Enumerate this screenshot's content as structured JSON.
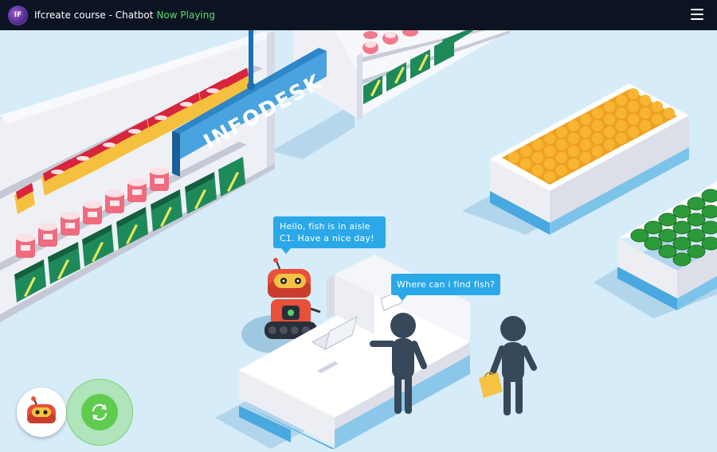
{
  "header": {
    "logo_text": "IF",
    "title": "Ifcreate course - Chatbot",
    "status": "Now Playing"
  },
  "scene": {
    "sign_text": "INFODESK",
    "bot_message": "Hello, fish is in aisle C1. Have a nice day!",
    "user_message": "Where can i find fish?"
  },
  "colors": {
    "topbar": "#0c1424",
    "background": "#d6ecf9",
    "bubble": "#2aa8e8",
    "status_green": "#5fdc6a",
    "restart_green": "#5fcc4f",
    "robot_red": "#e8503a"
  },
  "icons": {
    "menu": "hamburger-icon",
    "restart": "refresh-icon",
    "avatar": "robot-icon"
  }
}
